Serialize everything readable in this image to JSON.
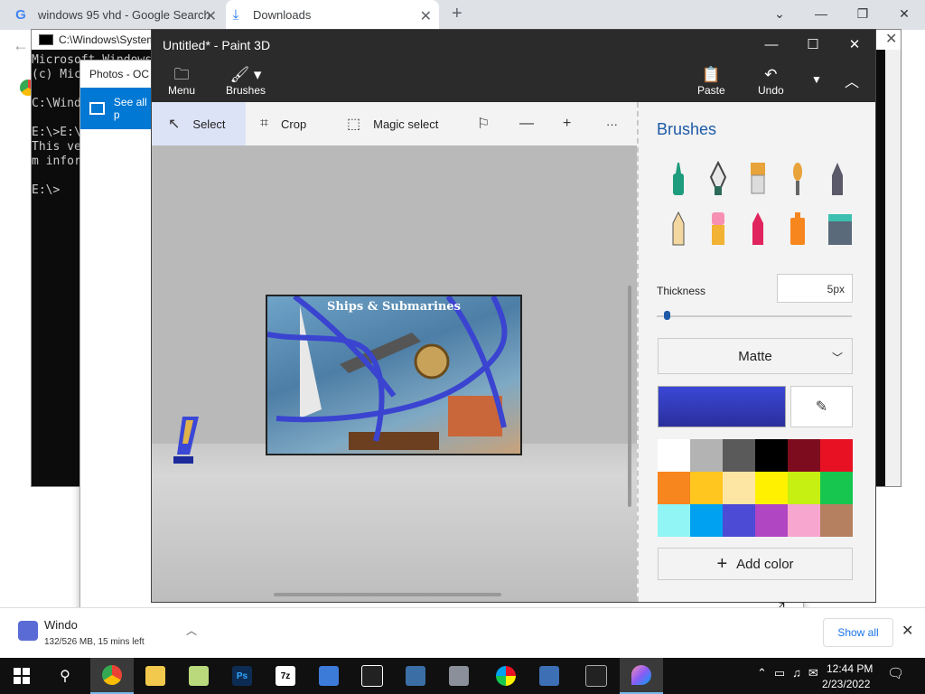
{
  "browser": {
    "tabs": [
      {
        "title": "windows 95 vhd - Google Search",
        "icon": "google-icon"
      },
      {
        "title": "Downloads",
        "icon": "download-icon"
      }
    ],
    "new_tab": "+",
    "min": "—",
    "max": "❐",
    "close": "✕"
  },
  "cmd": {
    "title": "C:\\Windows\\System",
    "lines": "Microsoft Windows\n(c) Microsoft\n\nC:\\Windows\n\nE:\\>E:\\\nThis ve                                                                                                   syste\nm infor\n\nE:\\>"
  },
  "photos": {
    "title": "Photos - OC",
    "see_all": "See all p"
  },
  "paint": {
    "title": "Untitled* - Paint 3D",
    "menu": "Menu",
    "brushes": "Brushes",
    "paste": "Paste",
    "undo": "Undo",
    "tools": {
      "select": "Select",
      "crop": "Crop",
      "magic_select": "Magic select",
      "more": "···"
    },
    "canvas_image_title": "Ships & Submarines",
    "panel": {
      "heading": "Brushes",
      "thickness_label": "Thickness",
      "thickness_value": "5px",
      "thickness_fraction": 0.05,
      "finish": "Matte",
      "add_color": "Add color"
    },
    "palette": [
      "#ffffff",
      "#b3b3b3",
      "#5a5a5a",
      "#000000",
      "#7d0d1e",
      "#e81123",
      "#f7861f",
      "#ffc61f",
      "#fde6a3",
      "#fff100",
      "#c5f011",
      "#16c64f",
      "#91f5f5",
      "#00a1f1",
      "#4b4bd6",
      "#b146c2",
      "#f7a6cf",
      "#b5805f"
    ],
    "accent_color": "#1e5aa8",
    "current_color": "#3b47d6"
  },
  "downloads": {
    "item_name": "Windo",
    "item_status": "132/526 MB, 15 mins left",
    "show_all": "Show all"
  },
  "taskbar": {
    "time": "12:44 PM",
    "date": "2/23/2022"
  }
}
